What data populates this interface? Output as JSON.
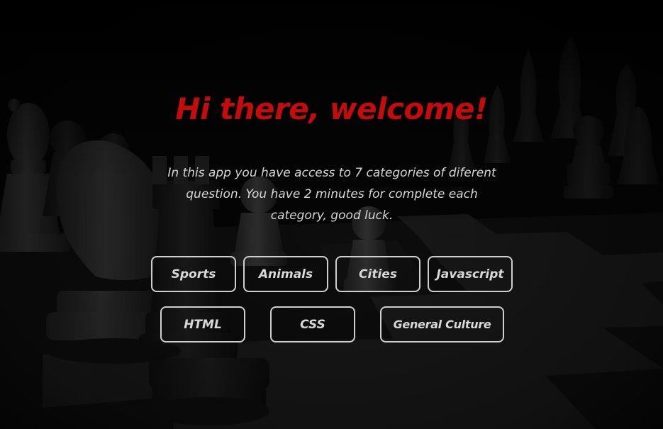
{
  "welcome": {
    "title": "Hi there, welcome!",
    "intro_lines": [
      "In this app you have access to 7 categories of diferent",
      "question. You have 2 minutes for complete each",
      "category, good luck."
    ]
  },
  "categories": {
    "sports": "Sports",
    "animals": "Animals",
    "cities": "Cities",
    "javascript": "Javascript",
    "html": "HTML",
    "css": "CSS",
    "general_culture": "General Culture"
  },
  "colors": {
    "title": "#c40c0c",
    "text": "#d6d6d6",
    "button_border": "#cfcfcf",
    "background": "#070707"
  }
}
